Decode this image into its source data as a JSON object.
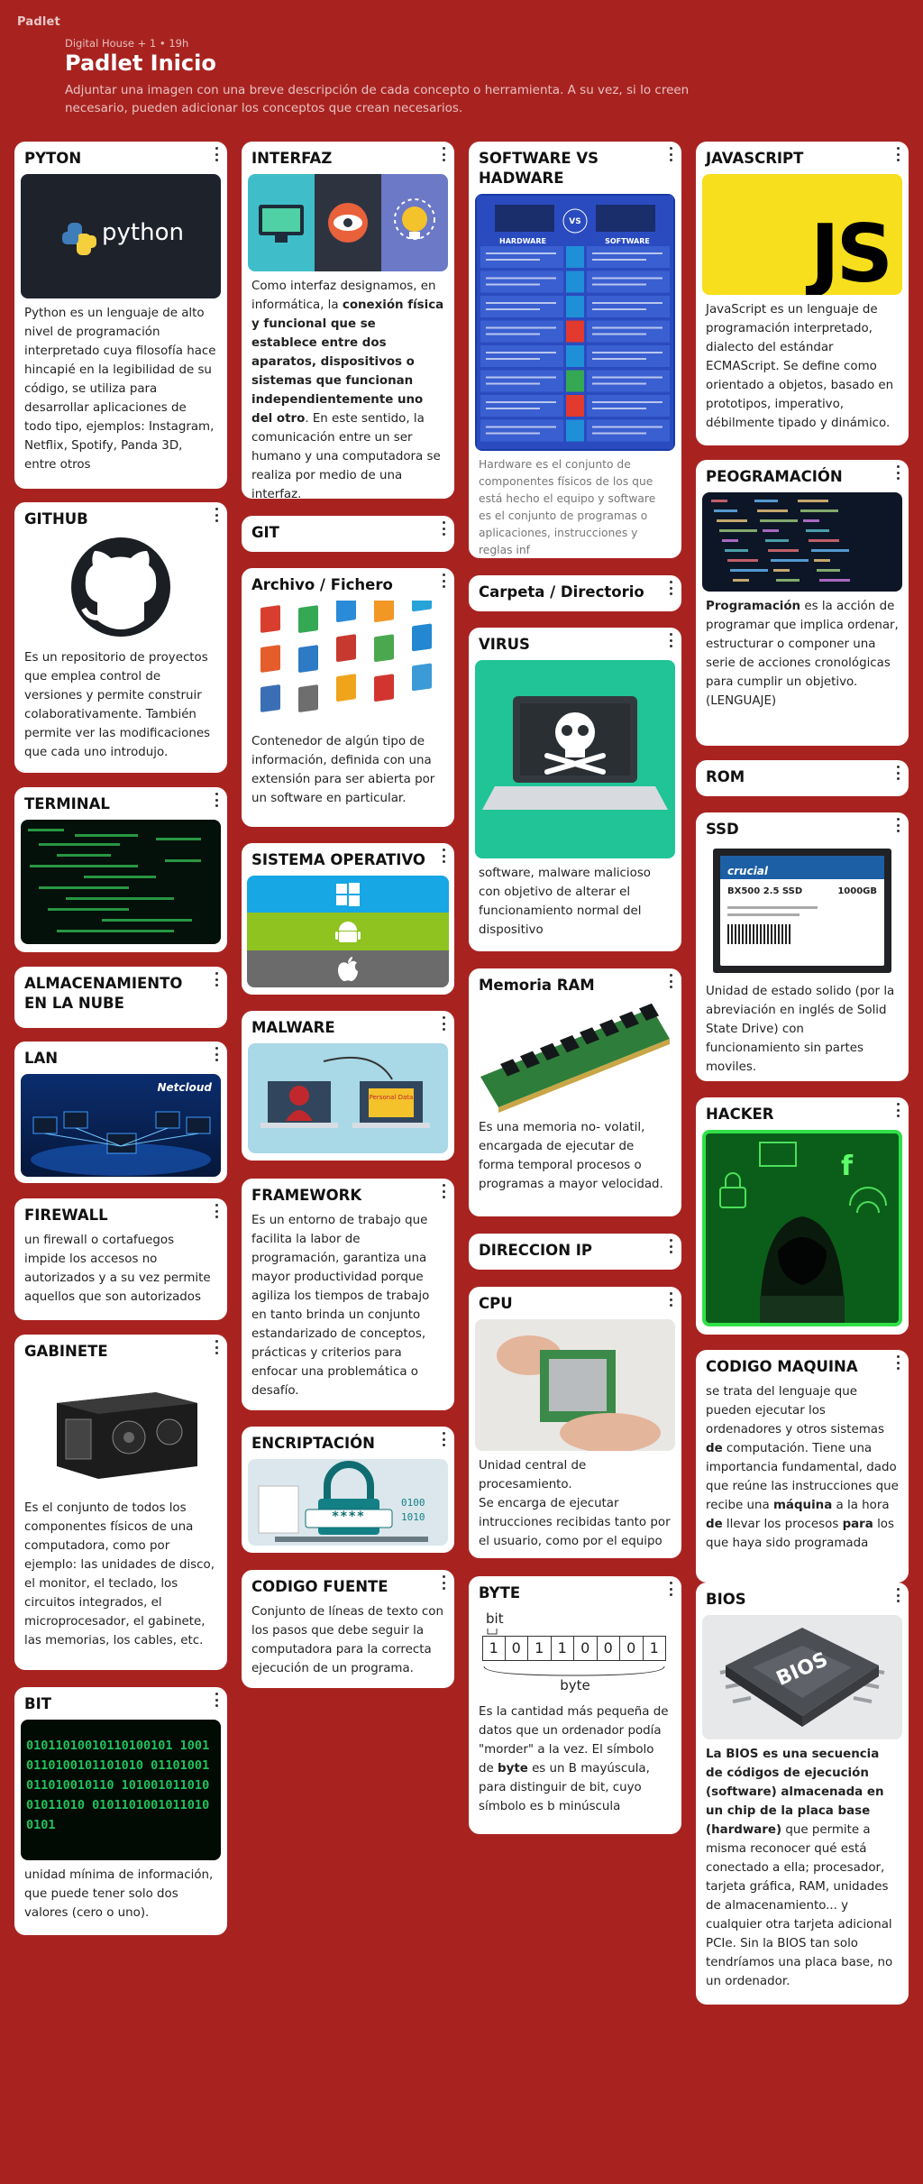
{
  "header": {
    "logo": "Padlet",
    "meta": "Digital House + 1 • 19h",
    "title": "Padlet Inicio",
    "description": "Adjuntar una imagen con una breve descripción de cada concepto o herramienta. A su vez, si lo creen necesario, pueden adicionar los conceptos que crean necesarios."
  },
  "posts": {
    "pyton": {
      "title": "PYTON",
      "image_text": "python",
      "body": "Python es un lenguaje de alto nivel de programación interpretado cuya filosofía hace hincapié en la legibilidad de su código, se utiliza para desarrollar aplicaciones de todo tipo, ejemplos: Instagram, Netflix, Spotify, Panda 3D, entre otros"
    },
    "github": {
      "title": "GITHUB",
      "body": "Es un repositorio de proyectos que emplea control de versiones y permite construir colaborativamente. También permite ver las modificaciones que cada uno introdujo."
    },
    "terminal": {
      "title": "TERMINAL"
    },
    "nube": {
      "title": "ALMACENAMIENTO EN LA NUBE"
    },
    "lan": {
      "title": "LAN",
      "image_text": "Netcloud"
    },
    "firewall": {
      "title": "FIREWALL",
      "body": "un firewall o cortafuegos impide los accesos no autorizados y a su vez permite aquellos que son autorizados"
    },
    "gabinete": {
      "title": "GABINETE",
      "body": "Es el conjunto de todos los componentes físicos de una computadora, como por ejemplo: las unidades de disco, el monitor, el teclado, los circuitos integrados, el microprocesador, el gabinete, las memorias, los cables, etc."
    },
    "bit": {
      "title": "BIT",
      "image_text": "01011010010110100101 10010110100101101010 01101001011010010110 10100101101001011010 01011010010110100101",
      "body": " unidad mínima de información, que puede tener solo dos valores (cero o uno)."
    },
    "interfaz": {
      "title": "INTERFAZ",
      "body_a": "Como interfaz designamos, en informática, la ",
      "body_b": "conexión física y funcional que se establece entre dos aparatos, dispositivos o sistemas que funcionan independientemente uno del otro",
      "body_c": ". En este sentido, la comunicación entre un ser humano y una computadora se realiza por medio de una interfaz."
    },
    "git": {
      "title": "GIT"
    },
    "archivo": {
      "title": "Archivo / Fichero",
      "body": "Contenedor de algún tipo de información, definida con una extensión para ser abierta por un software en particular."
    },
    "so": {
      "title": "SISTEMA OPERATIVO"
    },
    "malware": {
      "title": "MALWARE",
      "image_text": "Personal Data"
    },
    "framework": {
      "title": "FRAMEWORK",
      "body": "Es un entorno de trabajo que facilita la labor de programación, garantiza una mayor productividad porque agiliza los tiempos de trabajo en tanto brinda un conjunto estandarizado de conceptos, prácticas y criterios para enfocar una problemática o desafío."
    },
    "encriptacion": {
      "title": "ENCRIPTACIÓN",
      "image_text": "****"
    },
    "codigo_fuente": {
      "title": "CODIGO FUENTE",
      "body": "Conjunto de líneas de texto con los pasos que debe seguir la computadora para la correcta ejecución de un programa."
    },
    "software_hw": {
      "title": "SOFTWARE VS HADWARE",
      "image_hardware": "HARDWARE",
      "image_vs": "VS",
      "image_software": "SOFTWARE",
      "body": "Hardware es el conjunto de componentes físicos de los que está hecho el equipo y software es el conjunto de programas o aplicaciones, instrucciones y reglas inf"
    },
    "carpeta": {
      "title": "Carpeta / Directorio"
    },
    "virus": {
      "title": "VIRUS",
      "body": "software, malware malicioso con objetivo de alterar el funcionamiento normal del dispositivo"
    },
    "ram": {
      "title": "Memoria RAM",
      "body": "Es una memoria no- volatil, encargada de ejecutar de forma temporal procesos o programas a mayor velocidad."
    },
    "ip": {
      "title": "DIRECCION IP"
    },
    "cpu": {
      "title": "CPU",
      "body": "Unidad central de procesamiento.\nSe encarga de ejecutar intrucciones recibidas tanto por el usuario, como por el equipo"
    },
    "byte": {
      "title": "BYTE",
      "image_bit": "bit",
      "image_byte": "byte",
      "bits": [
        "1",
        "0",
        "1",
        "1",
        "0",
        "0",
        "0",
        "1"
      ],
      "body_a": "Es la cantidad más pequeña de datos que un ordenador podía \"morder\" a la vez. El símbolo de ",
      "body_b": "byte",
      "body_c": " es un B mayúscula, para distinguir de bit, cuyo símbolo es b minúscula"
    },
    "javascript": {
      "title": "JAVASCRIPT",
      "image_text": "JS",
      "body": "JavaScript es un lenguaje de programación interpretado, dialecto del estándar ECMAScript. Se define como orientado a objetos,  basado en prototipos, imperativo, débilmente tipado y dinámico."
    },
    "programacion": {
      "title": "PEOGRAMACIÓN",
      "body_a": "Programación",
      "body_b": " es la acción de programar que implica ordenar, estructurar o componer una serie de acciones cronológicas para cumplir un objetivo. (LENGUAJE)"
    },
    "rom": {
      "title": "ROM"
    },
    "ssd": {
      "title": "SSD",
      "image_brand": "crucial",
      "image_model": "BX500 2.5 SSD",
      "image_capacity": "1000GB",
      "body": "Unidad de estado solido (por la abreviación en inglés de Solid State Drive) con funcionamiento sin partes moviles."
    },
    "hacker": {
      "title": "HACKER"
    },
    "codigo_maquina": {
      "title": "CODIGO MAQUINA",
      "body_1": "se trata del lenguaje que pueden ejecutar los ordenadores y otros sistemas ",
      "body_2": "de",
      "body_3": " computación. Tiene una importancia fundamental, dado que reúne las instrucciones que recibe una ",
      "body_4": "máquina",
      "body_5": " a la hora ",
      "body_6": "de",
      "body_7": " llevar los procesos ",
      "body_8": "para",
      "body_9": " los que haya sido programada"
    },
    "bios": {
      "title": "BIOS",
      "image_text": "BIOS",
      "body_a": "La BIOS es una secuencia de códigos de ejecución (software) almacenada en un chip de la placa base (hardware)",
      "body_b": " que permite a misma reconocer qué está conectado a ella; procesador, tarjeta gráfica, RAM, unidades de almacenamiento... y cualquier otra tarjeta adicional PCIe. Sin la BIOS tan solo tendríamos una placa base, no un ordenador."
    }
  },
  "colors": {
    "background": "#a82320",
    "card": "#ffffff",
    "js_yellow": "#f7df1e"
  }
}
